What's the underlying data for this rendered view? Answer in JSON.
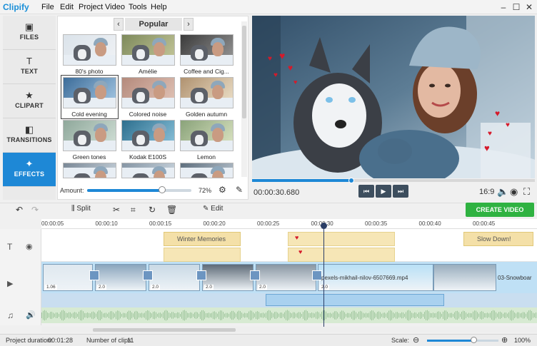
{
  "app": {
    "logo": "Clipify"
  },
  "menu": [
    "File",
    "Edit",
    "Project",
    "Video",
    "Tools",
    "Help"
  ],
  "window": {
    "min": "–",
    "max": "☐",
    "close": "✕"
  },
  "nav": [
    {
      "label": "FILES",
      "icon": "image-icon",
      "glyph": "▣"
    },
    {
      "label": "TEXT",
      "icon": "text-t-icon",
      "glyph": "T"
    },
    {
      "label": "CLIPART",
      "icon": "star-icon",
      "glyph": "★"
    },
    {
      "label": "TRANSITIONS",
      "icon": "transitions-icon",
      "glyph": "◧"
    },
    {
      "label": "EFFECTS",
      "icon": "magic-wand-icon",
      "glyph": "✦"
    }
  ],
  "effects": {
    "category": "Popular",
    "prev": "‹",
    "next": "›",
    "thumbs": [
      {
        "label": "80's photo",
        "tone": "#dbe3ea",
        "tint": "#f0f2f5"
      },
      {
        "label": "Amélie",
        "tone": "#7e8a5c",
        "tint": "#c7c99c"
      },
      {
        "label": "Coffee and Cig...",
        "tone": "#3b3b3b",
        "tint": "#9a9a9a"
      },
      {
        "label": "Cold evening",
        "tone": "#3c6c99",
        "tint": "#a9cbe6"
      },
      {
        "label": "Colored noise",
        "tone": "#b48a7c",
        "tint": "#e3c6b9"
      },
      {
        "label": "Golden autumn",
        "tone": "#b09270",
        "tint": "#efe3cc"
      },
      {
        "label": "Green tones",
        "tone": "#8fa89b",
        "tint": "#d4e2d9"
      },
      {
        "label": "Kodak E100S",
        "tone": "#2d6f8e",
        "tint": "#8fc6de"
      },
      {
        "label": "Lemon",
        "tone": "#8aa37a",
        "tint": "#dfe7c6"
      },
      {
        "label": "",
        "tone": "#7a8896",
        "tint": "#c7d2db"
      },
      {
        "label": "",
        "tone": "#8595a4",
        "tint": "#cbd6df"
      },
      {
        "label": "",
        "tone": "#5f6f7e",
        "tint": "#b6c2cc"
      }
    ],
    "selected": 3,
    "amount_label": "Amount:",
    "amount_value": "72%",
    "amount_fraction": 0.72
  },
  "player": {
    "timecode": "00:00:30.680",
    "progress_fraction": 0.35,
    "aspect": "16:9",
    "prev_glyph": "⏮",
    "play_glyph": "▶",
    "next_glyph": "⏭"
  },
  "toolbar": {
    "split": "Split",
    "edit": "Edit",
    "create": "CREATE VIDEO"
  },
  "ruler": [
    "00:00:05",
    "00:00:10",
    "00:00:15",
    "00:00:20",
    "00:00:25",
    "00:00:30",
    "00:00:35",
    "00:00:40",
    "00:00:45"
  ],
  "timeline": {
    "text_clips": [
      "Winter Memories",
      "Slow Down!"
    ],
    "clip_badges": [
      "1.06",
      "2.0",
      "2.0",
      "2.0",
      "2.0",
      "2.0"
    ],
    "video_label": "pexels-mikhail-nilov-6507669.mp4",
    "video_label2": "03-Snowboar"
  },
  "status": {
    "duration_label": "Project duration:",
    "duration": "00:01:28",
    "clips_label": "Number of clips:",
    "clips": "11",
    "scale_label": "Scale:",
    "zoom": "100%",
    "zoom_fraction": 0.65
  }
}
